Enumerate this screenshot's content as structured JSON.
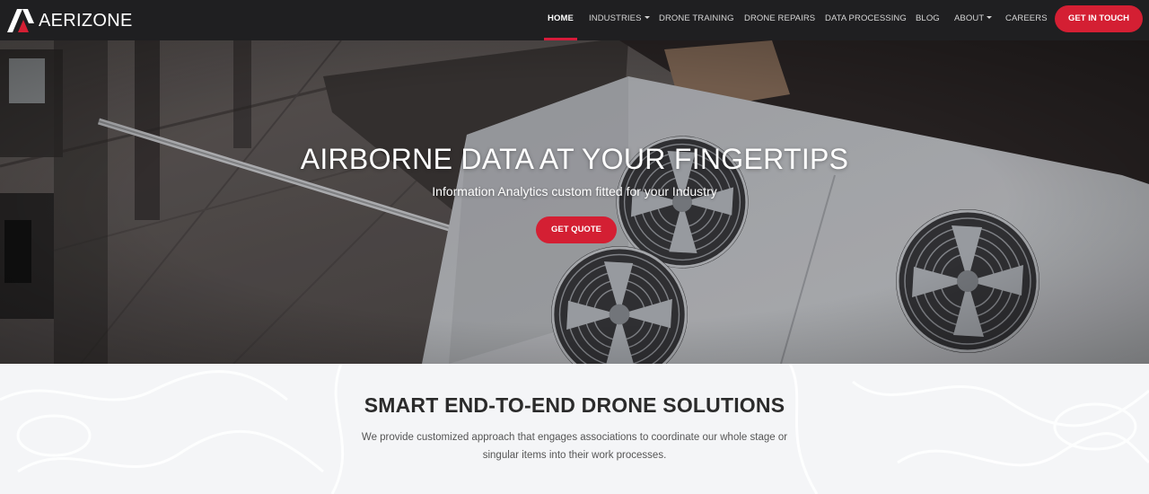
{
  "brand": {
    "name": "AERIZONE",
    "logo_icon": "aerizone-a-logo-icon",
    "accent_color": "#d41f33"
  },
  "nav": {
    "items": [
      {
        "label": "HOME",
        "active": true,
        "dropdown": false
      },
      {
        "label": "INDUSTRIES",
        "active": false,
        "dropdown": true
      },
      {
        "label": "DRONE TRAINING",
        "active": false,
        "dropdown": false
      },
      {
        "label": "DRONE REPAIRS",
        "active": false,
        "dropdown": false
      },
      {
        "label": "DATA PROCESSING",
        "active": false,
        "dropdown": false
      },
      {
        "label": "BLOG",
        "active": false,
        "dropdown": false
      },
      {
        "label": "ABOUT",
        "active": false,
        "dropdown": true
      },
      {
        "label": "CAREERS",
        "active": false,
        "dropdown": false
      }
    ],
    "cta_label": "GET IN TOUCH"
  },
  "hero": {
    "title": "AIRBORNE DATA AT YOUR FINGERTIPS",
    "subtitle": "Information Analytics custom fitted for your Industry",
    "button_label": "GET QUOTE"
  },
  "intro": {
    "title": "SMART END-TO-END DRONE SOLUTIONS",
    "text": "We provide customized approach that engages associations to coordinate our whole stage or singular items into their work processes."
  }
}
